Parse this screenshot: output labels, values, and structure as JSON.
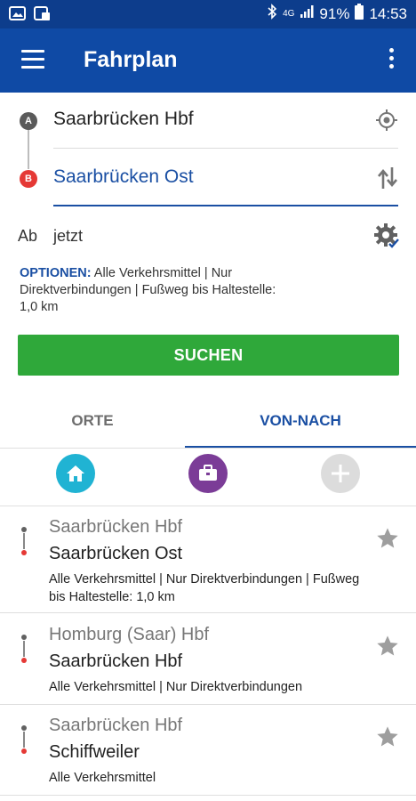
{
  "status_bar": {
    "battery": "91%",
    "time": "14:53",
    "network": "4G"
  },
  "app_bar": {
    "title": "Fahrplan"
  },
  "route": {
    "from_pin": "A",
    "to_pin": "B",
    "from": "Saarbrücken Hbf",
    "to": "Saarbrücken Ost",
    "time_label": "Ab",
    "time_value": "jetzt"
  },
  "options": {
    "label": "OPTIONEN:",
    "text": "Alle Verkehrsmittel | Nur Direktverbindungen | Fußweg bis Haltestelle: 1,0 km"
  },
  "search_button": "SUCHEN",
  "tabs": [
    {
      "label": "ORTE",
      "active": false
    },
    {
      "label": "VON-NACH",
      "active": true
    }
  ],
  "shortcuts": [
    {
      "icon": "home-icon",
      "color": "#20b3d3"
    },
    {
      "icon": "briefcase-icon",
      "color": "#7b3c97"
    },
    {
      "icon": "plus-icon",
      "color": "#dcdcdc"
    }
  ],
  "connections": [
    {
      "from": "Saarbrücken Hbf",
      "to": "Saarbrücken Ost",
      "details": "Alle Verkehrsmittel | Nur Direktverbindungen | Fußweg bis Haltestelle: 1,0 km"
    },
    {
      "from": "Homburg (Saar) Hbf",
      "to": "Saarbrücken Hbf",
      "details": "Alle Verkehrsmittel | Nur Direktverbindungen"
    },
    {
      "from": "Saarbrücken Hbf",
      "to": "Schiffweiler",
      "details": "Alle Verkehrsmittel"
    }
  ],
  "colors": {
    "primary": "#0f4aa5",
    "status_bar": "#0d3d8c",
    "accent": "#1a4fa3",
    "search_green": "#2fa83a",
    "pin_b": "#e53935"
  }
}
